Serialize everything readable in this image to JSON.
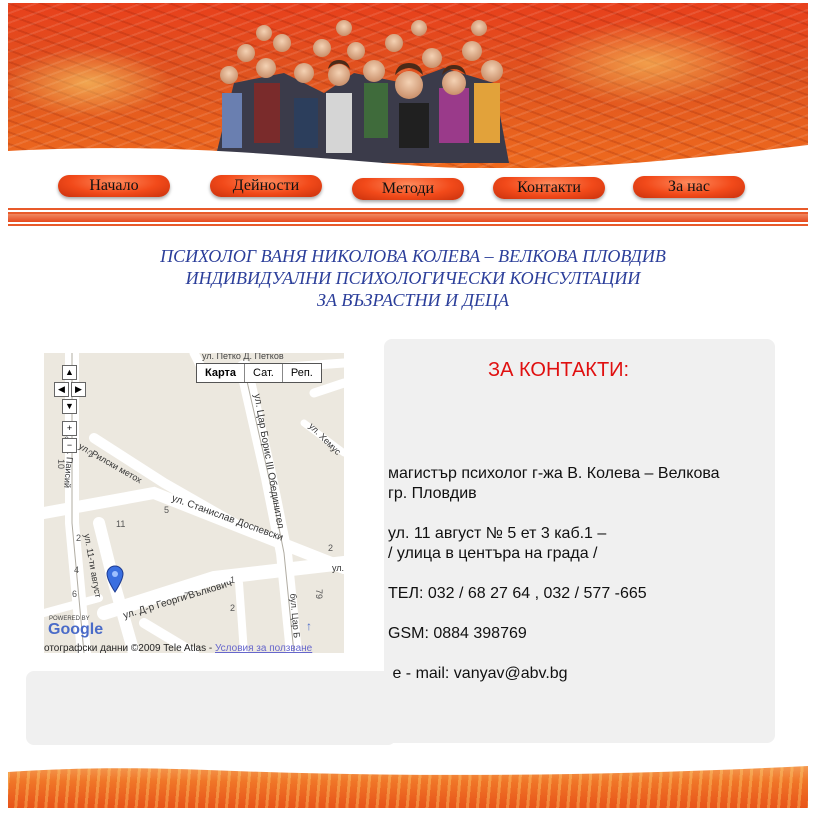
{
  "nav": {
    "items": [
      "Начало",
      "Дейности",
      "Методи",
      "Контакти",
      "За нас"
    ]
  },
  "title": {
    "line1": "ПСИХОЛОГ ВАНЯ НИКОЛОВА КОЛЕВА – ВЕЛКОВА  ПЛОВДИВ",
    "line2": "ИНДИВИДУАЛНИ ПСИХОЛОГИЧЕСКИ КОНСУЛТАЦИИ",
    "line3": "ЗА ВЪЗРАСТНИ И ДЕЦА"
  },
  "map": {
    "type_buttons": [
      "Карта",
      "Сат.",
      "Реп."
    ],
    "streets": {
      "rilski": "ул. Рилски метох",
      "stanislav": "ул. Станислав Доспевски",
      "tsar_boris": "ул. Цар Борис III Обединител",
      "georgi": "ул. Д-р Георги Вълкович",
      "august": "ул. 11-ти август",
      "paisii": "ул. Паисий",
      "hemus": "ул. Хемус",
      "tsar_b2": "бул. Цар Б",
      "ul": "ул.",
      "top": "ул. Петко Д. Петков"
    },
    "numbers": [
      "10",
      "6",
      "2",
      "11",
      "2",
      "4",
      "6",
      "5",
      "7",
      "2",
      "1",
      "2",
      "79"
    ],
    "powered": "POWERED BY",
    "google": "Google",
    "copyright": "отографски данни ©2009 Tele Atlas - ",
    "terms": "Условия за ползване"
  },
  "contact": {
    "heading": "ЗА КОНТАКТИ:",
    "name": "магистър психолог г-жа В. Колева – Велкова",
    "city": "гр. Пловдив",
    "address1": "ул. 11 август № 5  ет 3 каб.1 –",
    "address2": "/ улица в центъра на града /",
    "phone": "ТЕЛ: 032 / 68 27 64 , 032 / 577 -665",
    "gsm": "GSM: 0884 398769",
    "email": " e - mail: vanyav@abv.bg"
  },
  "colors": {
    "title": "#2b3e9a",
    "contact_heading": "#e01010",
    "accent": "#e8481c"
  },
  "icons": [
    "map-marker-icon",
    "pan-up-icon",
    "pan-left-icon",
    "pan-right-icon",
    "pan-down-icon",
    "zoom-in-icon",
    "zoom-out-icon",
    "north-arrow-icon"
  ]
}
